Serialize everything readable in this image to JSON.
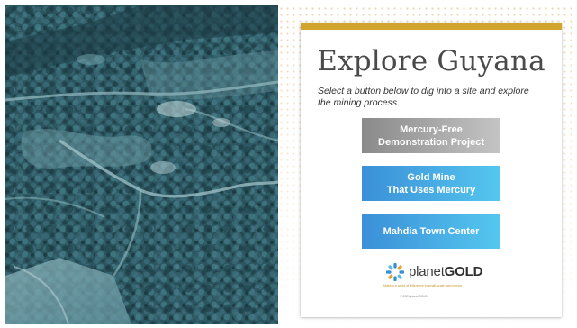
{
  "title": "Explore Guyana",
  "subtitle": "Select a button below to dig into a site and explore the mining process.",
  "buttons": {
    "mercury_free_line1": "Mercury-Free",
    "mercury_free_line2": "Demonstration Project",
    "gold_mine_line1": "Gold Mine",
    "gold_mine_line2": "That Uses Mercury",
    "town_center": "Mahdia Town Center"
  },
  "logo": {
    "name_light": "planet",
    "name_bold": "GOLD",
    "tagline": "Making a world of difference in small-scale gold mining",
    "copyright": "© 2021 planetGOLD"
  },
  "photo": {
    "icon": "aerial-mining-photo"
  },
  "colors": {
    "accent_gold": "#d1a52d",
    "button_gray": "#9a9a9a",
    "button_blue": "#45aee4",
    "photo_tint": "#2c5560"
  }
}
